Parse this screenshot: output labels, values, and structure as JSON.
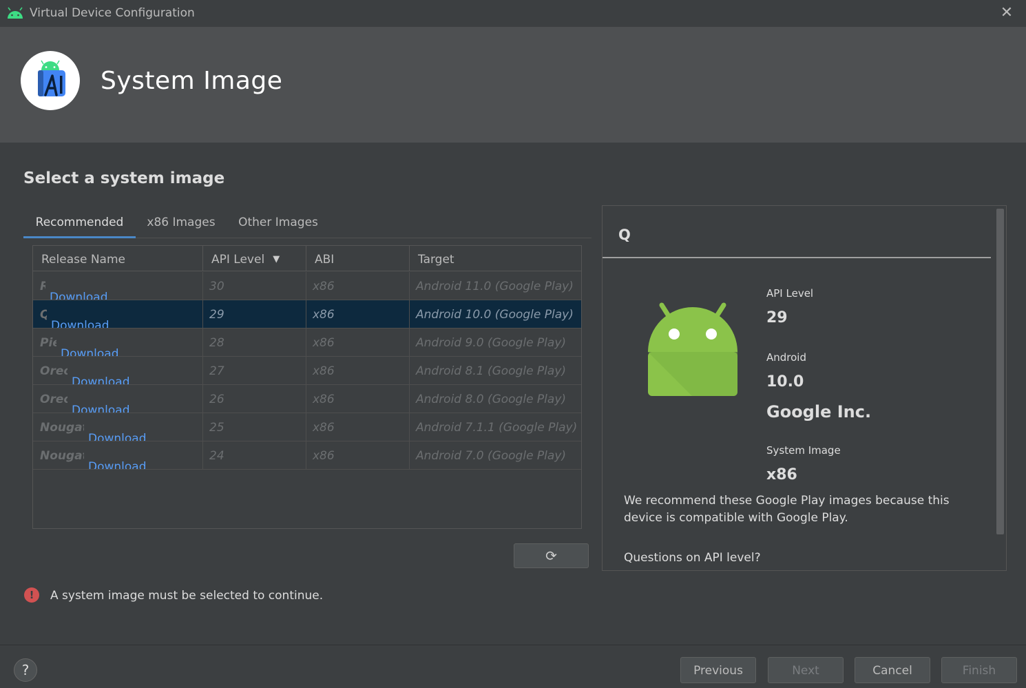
{
  "window": {
    "title": "Virtual Device Configuration",
    "close_glyph": "✕"
  },
  "header": {
    "title": "System Image"
  },
  "section_title": "Select a system image",
  "tabs": [
    {
      "label": "Recommended",
      "active": true
    },
    {
      "label": "x86 Images",
      "active": false
    },
    {
      "label": "Other Images",
      "active": false
    }
  ],
  "table": {
    "columns": [
      "Release Name",
      "API Level",
      "ABI",
      "Target"
    ],
    "sort_icon": "▼",
    "rows": [
      {
        "name": "R",
        "link": "Download",
        "api": "30",
        "abi": "x86",
        "target": "Android 11.0 (Google Play)",
        "selected": false
      },
      {
        "name": "Q",
        "link": "Download",
        "api": "29",
        "abi": "x86",
        "target": "Android 10.0 (Google Play)",
        "selected": true
      },
      {
        "name": "Pie",
        "link": "Download",
        "api": "28",
        "abi": "x86",
        "target": "Android 9.0 (Google Play)",
        "selected": false
      },
      {
        "name": "Oreo",
        "link": "Download",
        "api": "27",
        "abi": "x86",
        "target": "Android 8.1 (Google Play)",
        "selected": false
      },
      {
        "name": "Oreo",
        "link": "Download",
        "api": "26",
        "abi": "x86",
        "target": "Android 8.0 (Google Play)",
        "selected": false
      },
      {
        "name": "Nougat",
        "link": "Download",
        "api": "25",
        "abi": "x86",
        "target": "Android 7.1.1 (Google Play)",
        "selected": false
      },
      {
        "name": "Nougat",
        "link": "Download",
        "api": "24",
        "abi": "x86",
        "target": "Android 7.0 (Google Play)",
        "selected": false
      }
    ]
  },
  "refresh_glyph": "⟳",
  "detail": {
    "name": "Q",
    "api_label": "API Level",
    "api_value": "29",
    "android_label": "Android",
    "android_value": "10.0",
    "vendor": "Google Inc.",
    "sysimg_label": "System Image",
    "sysimg_value": "x86",
    "recommend_text": "We recommend these Google Play images because this device is compatible with Google Play.",
    "questions": "Questions on API level?"
  },
  "error": {
    "icon": "!",
    "text": "A system image must be selected to continue."
  },
  "footer": {
    "help": "?",
    "previous": "Previous",
    "next": "Next",
    "cancel": "Cancel",
    "finish": "Finish"
  }
}
